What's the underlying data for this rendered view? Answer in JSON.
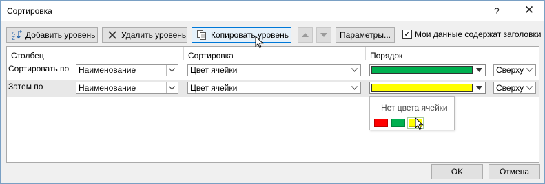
{
  "window": {
    "title": "Сортировка",
    "help_glyph": "?",
    "close_glyph": "✕"
  },
  "toolbar": {
    "add_level": "Добавить уровень",
    "delete_level": "Удалить уровень",
    "copy_level": "Копировать уровень",
    "options": "Параметры...",
    "headers_checkbox_label": "Мои данные содержат заголовки",
    "headers_checked": true,
    "checkmark": "✓"
  },
  "columns": {
    "column": "Столбец",
    "sort_on": "Сортировка",
    "order": "Порядок"
  },
  "rows": [
    {
      "label": "Сортировать по",
      "column": "Наименование",
      "sort_on": "Цвет ячейки",
      "color": "#00b050",
      "position": "Сверху"
    },
    {
      "label": "Затем по",
      "column": "Наименование",
      "sort_on": "Цвет ячейки",
      "color": "#ffff00",
      "position": "Сверху"
    }
  ],
  "color_popup": {
    "no_color": "Нет цвета ячейки",
    "swatches": [
      "#ff0000",
      "#00b050",
      "#ffff00"
    ]
  },
  "buttons": {
    "ok": "OK",
    "cancel": "Отмена"
  }
}
